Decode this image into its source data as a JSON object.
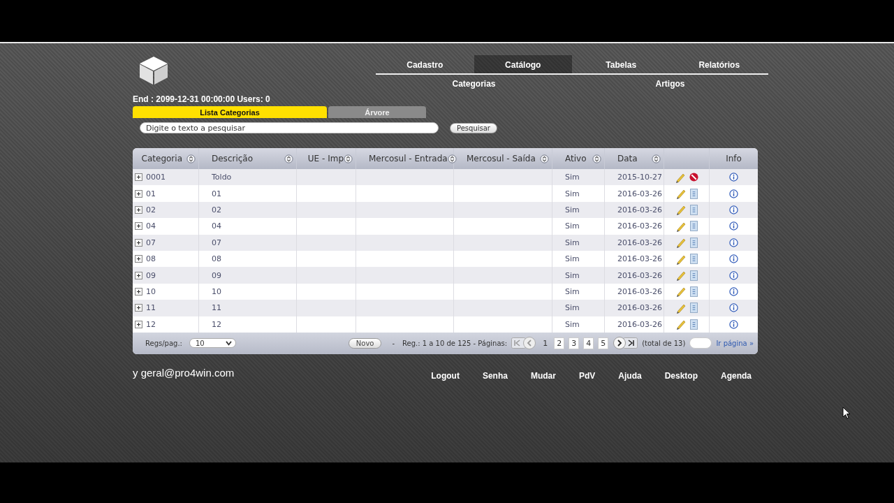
{
  "header": {
    "status": "End : 2099-12-31 00:00:00 Users: 0"
  },
  "menu": [
    {
      "label": "Cadastro",
      "selected": false
    },
    {
      "label": "Catálogo",
      "selected": true
    },
    {
      "label": "Tabelas",
      "selected": false
    },
    {
      "label": "Relatórios",
      "selected": false
    }
  ],
  "submenu": [
    "Categorias",
    "Artigos"
  ],
  "tabs": [
    {
      "label": "Lista Categorias",
      "selected": true
    },
    {
      "label": "Árvore",
      "selected": false
    }
  ],
  "search": {
    "placeholder": "Digite o texto a pesquisar",
    "button": "Pesquisar"
  },
  "table": {
    "columns": [
      {
        "label": "Categoria",
        "sortable": true
      },
      {
        "label": "Descrição",
        "sortable": true
      },
      {
        "label": "UE - Imp",
        "sortable": true
      },
      {
        "label": "Mercosul - Entrada",
        "sortable": true
      },
      {
        "label": "Mercosul - Saída",
        "sortable": true
      },
      {
        "label": "Ativo",
        "sortable": true
      },
      {
        "label": "Data",
        "sortable": true
      },
      {
        "sortable": false
      },
      {
        "label": "Info",
        "sortable": false
      }
    ],
    "rows": [
      {
        "categoria": "0001",
        "descricao": "Toldo",
        "ativo": "Sim",
        "data": "2015-10-27",
        "kind": "blocked"
      },
      {
        "categoria": "01",
        "descricao": "01",
        "ativo": "Sim",
        "data": "2016-03-26",
        "kind": "sync"
      },
      {
        "categoria": "02",
        "descricao": "02",
        "ativo": "Sim",
        "data": "2016-03-26",
        "kind": "sync"
      },
      {
        "categoria": "04",
        "descricao": "04",
        "ativo": "Sim",
        "data": "2016-03-26",
        "kind": "sync"
      },
      {
        "categoria": "07",
        "descricao": "07",
        "ativo": "Sim",
        "data": "2016-03-26",
        "kind": "sync"
      },
      {
        "categoria": "08",
        "descricao": "08",
        "ativo": "Sim",
        "data": "2016-03-26",
        "kind": "sync"
      },
      {
        "categoria": "09",
        "descricao": "09",
        "ativo": "Sim",
        "data": "2016-03-26",
        "kind": "sync"
      },
      {
        "categoria": "10",
        "descricao": "10",
        "ativo": "Sim",
        "data": "2016-03-26",
        "kind": "sync"
      },
      {
        "categoria": "11",
        "descricao": "11",
        "ativo": "Sim",
        "data": "2016-03-26",
        "kind": "sync"
      },
      {
        "categoria": "12",
        "descricao": "12",
        "ativo": "Sim",
        "data": "2016-03-26",
        "kind": "sync"
      }
    ]
  },
  "pager": {
    "per_page_label": "Regs/pag.:",
    "per_page": "10",
    "new_button": "Novo",
    "separator": "-",
    "summary": "Reg.: 1 a 10 de 125 - Páginas:",
    "pages": [
      {
        "label": "1",
        "selected": true
      },
      {
        "label": "2",
        "selected": false
      },
      {
        "label": "3",
        "selected": false
      },
      {
        "label": "4",
        "selected": false
      },
      {
        "label": "5",
        "selected": false
      }
    ],
    "total": "(total de 13)",
    "goto": "Ir página »"
  },
  "footer": {
    "email": "y geral@pro4win.com",
    "links": [
      "Logout",
      "Senha",
      "Mudar",
      "PdV",
      "Ajuda",
      "Desktop",
      "Agenda"
    ]
  }
}
